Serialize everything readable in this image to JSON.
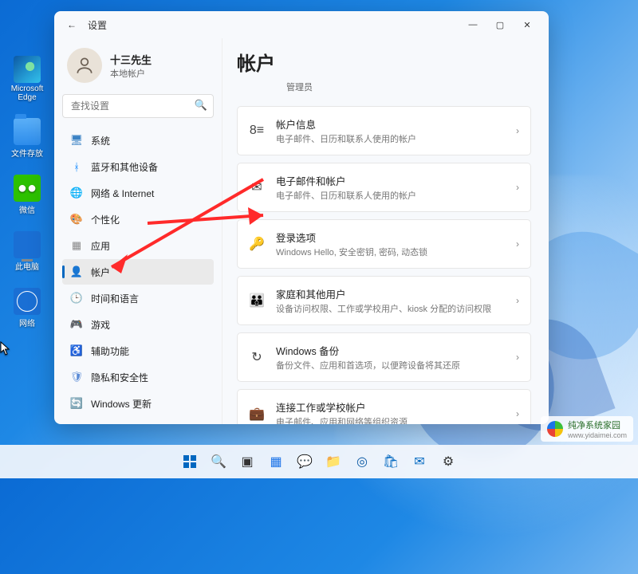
{
  "desktop": {
    "icons": [
      {
        "name": "edge",
        "label": "Microsoft Edge"
      },
      {
        "name": "folder",
        "label": "文件存放"
      },
      {
        "name": "wechat",
        "label": "微信"
      },
      {
        "name": "pc",
        "label": "此电脑"
      },
      {
        "name": "network",
        "label": "网络"
      }
    ]
  },
  "window": {
    "title": "设置",
    "profile": {
      "name": "十三先生",
      "sub": "本地帐户"
    },
    "search": {
      "placeholder": "查找设置"
    },
    "nav": [
      {
        "icon": "system",
        "label": "系统",
        "color": "#3b82c4"
      },
      {
        "icon": "bluetooth",
        "label": "蓝牙和其他设备",
        "color": "#0a84ff"
      },
      {
        "icon": "network",
        "label": "网络 & Internet",
        "color": "#00a2c7"
      },
      {
        "icon": "personalize",
        "label": "个性化",
        "color": "#b04a8b"
      },
      {
        "icon": "apps",
        "label": "应用",
        "color": "#8a8a8a"
      },
      {
        "icon": "accounts",
        "label": "帐户",
        "color": "#6b7fa0",
        "selected": true
      },
      {
        "icon": "time",
        "label": "时间和语言",
        "color": "#444"
      },
      {
        "icon": "gaming",
        "label": "游戏",
        "color": "#6fb06f"
      },
      {
        "icon": "accessibility",
        "label": "辅助功能",
        "color": "#1f6bb8"
      },
      {
        "icon": "privacy",
        "label": "隐私和安全性",
        "color": "#5a8bd6"
      },
      {
        "icon": "update",
        "label": "Windows 更新",
        "color": "#00a2c7"
      }
    ],
    "main": {
      "title": "帐户",
      "subtitle": "管理员",
      "cards": [
        {
          "icon": "id",
          "title": "帐户信息",
          "sub": "电子邮件、日历和联系人使用的帐户"
        },
        {
          "icon": "mail",
          "title": "电子邮件和帐户",
          "sub": "电子邮件、日历和联系人使用的帐户"
        },
        {
          "icon": "key",
          "title": "登录选项",
          "sub": "Windows Hello, 安全密钥, 密码, 动态锁"
        },
        {
          "icon": "family",
          "title": "家庭和其他用户",
          "sub": "设备访问权限、工作或学校用户、kiosk 分配的访问权限"
        },
        {
          "icon": "backup",
          "title": "Windows 备份",
          "sub": "备份文件、应用和首选项，以便跨设备将其还原"
        },
        {
          "icon": "work",
          "title": "连接工作或学校帐户",
          "sub": "电子邮件、应用和网络等组织资源"
        }
      ]
    }
  },
  "taskbar": {
    "items": [
      "start",
      "search",
      "taskview",
      "widgets",
      "chat",
      "explorer",
      "edge",
      "store",
      "mail",
      "settings"
    ]
  },
  "watermark": {
    "brand": "纯净系统家园",
    "site": "www.yidaimei.com"
  }
}
